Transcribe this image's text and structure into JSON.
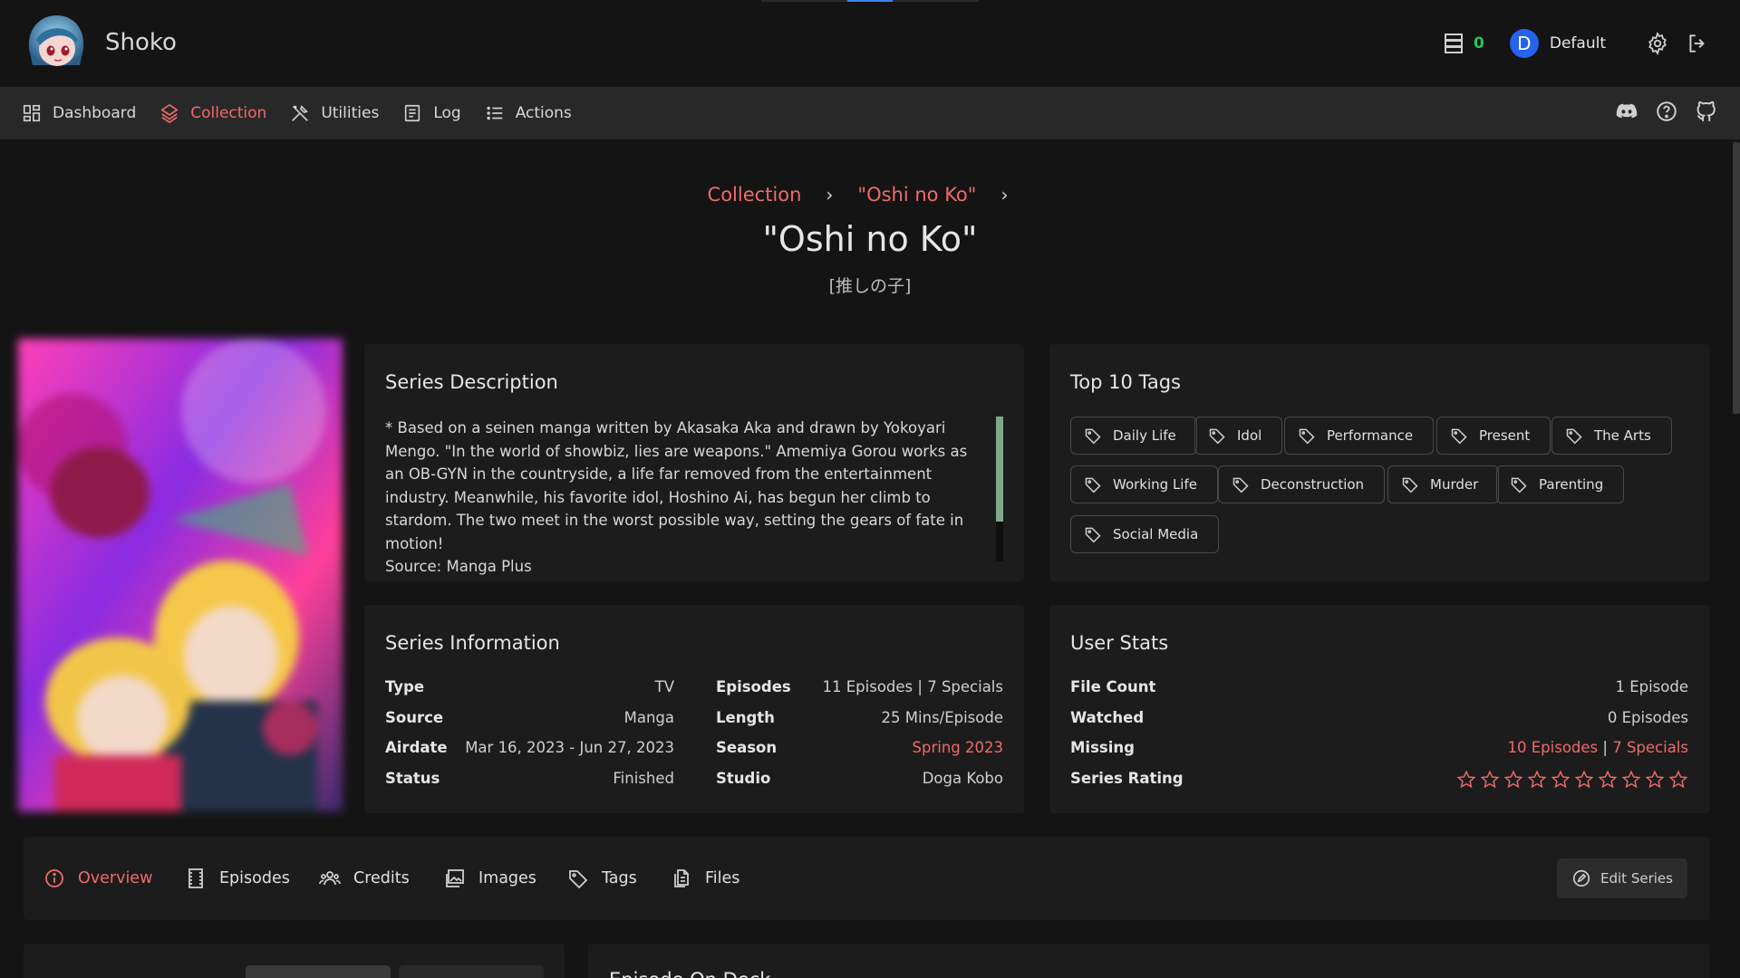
{
  "app": {
    "name": "Shoko"
  },
  "topbar": {
    "queue_count": "0",
    "user_initial": "D",
    "user_name": "Default",
    "progress_indicator": 0.4
  },
  "nav": {
    "items": [
      {
        "label": "Dashboard",
        "icon": "dashboard-icon"
      },
      {
        "label": "Collection",
        "icon": "layers-icon",
        "active": true
      },
      {
        "label": "Utilities",
        "icon": "tools-icon"
      },
      {
        "label": "Log",
        "icon": "log-icon"
      },
      {
        "label": "Actions",
        "icon": "list-icon"
      }
    ],
    "right_icons": [
      "discord-icon",
      "help-icon",
      "github-icon"
    ]
  },
  "breadcrumb": {
    "items": [
      "Collection",
      "\"Oshi no Ko\""
    ]
  },
  "series": {
    "title": "\"Oshi no Ko\"",
    "subtitle": "[推しの子]"
  },
  "description": {
    "title": "Series Description",
    "text": "* Based on a seinen manga written by Akasaka Aka and drawn by Yokoyari Mengo. \"In the world of showbiz, lies are weapons.\" Amemiya Gorou works as an OB-GYN in the countryside, a life far removed from the entertainment industry. Meanwhile, his favorite idol, Hoshino Ai, has begun her climb to stardom. The two meet in the worst possible way, setting the gears of fate in motion!",
    "source": "Source: Manga Plus"
  },
  "tags": {
    "title": "Top 10 Tags",
    "items": [
      "Daily Life",
      "Idol",
      "Performance",
      "Present",
      "The Arts",
      "Working Life",
      "Deconstruction",
      "Murder",
      "Parenting",
      "Social Media"
    ]
  },
  "info": {
    "title": "Series Information",
    "left": [
      {
        "key": "Type",
        "value": "TV"
      },
      {
        "key": "Source",
        "value": "Manga"
      },
      {
        "key": "Airdate",
        "value": "Mar 16, 2023 - Jun 27, 2023"
      },
      {
        "key": "Status",
        "value": "Finished"
      }
    ],
    "right": [
      {
        "key": "Episodes",
        "value": "11 Episodes | 7 Specials"
      },
      {
        "key": "Length",
        "value": "25 Mins/Episode"
      },
      {
        "key": "Season",
        "value": "Spring 2023"
      },
      {
        "key": "Studio",
        "value": "Doga Kobo"
      }
    ]
  },
  "stats": {
    "title": "User Stats",
    "file_count_label": "File Count",
    "file_count": "1 Episode",
    "watched_label": "Watched",
    "watched": "0 Episodes",
    "missing_label": "Missing",
    "missing_episodes": "10 Episodes",
    "missing_separator": " | ",
    "missing_specials": "7 Specials",
    "rating_label": "Series Rating",
    "rating_value": 0,
    "rating_max": 10
  },
  "tabs": {
    "items": [
      {
        "label": "Overview",
        "icon": "info-icon",
        "active": true
      },
      {
        "label": "Episodes",
        "icon": "film-icon"
      },
      {
        "label": "Credits",
        "icon": "people-icon"
      },
      {
        "label": "Images",
        "icon": "image-icon"
      },
      {
        "label": "Tags",
        "icon": "tag-icon"
      },
      {
        "label": "Files",
        "icon": "files-icon"
      }
    ],
    "edit_label": "Edit Series"
  },
  "bottom": {
    "episode_on_deck_title": "Episode On Deck"
  },
  "colors": {
    "accent": "#f06a6a",
    "queue": "#22c55e",
    "avatar": "#2563eb"
  }
}
